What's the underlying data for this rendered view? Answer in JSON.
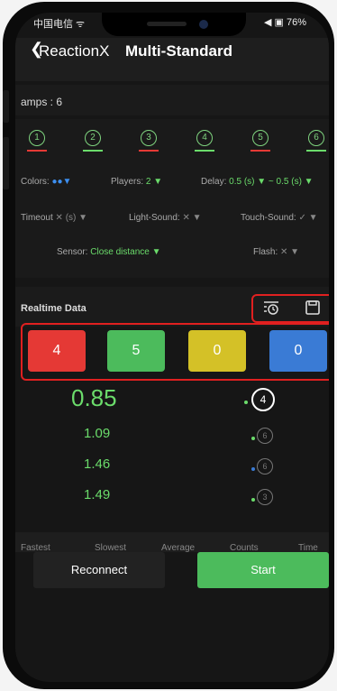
{
  "status_bar": {
    "carrier": "中国电信 ᯤ",
    "battery": "◀ ▣ 76%"
  },
  "header": {
    "back_symbol": "❮",
    "app_name": "ReactionX",
    "title": "Multi-Standard"
  },
  "lamps": {
    "label": "amps : 6",
    "items": [
      {
        "num": "1",
        "bar_color": "#e53935"
      },
      {
        "num": "2",
        "bar_color": "#6bdc6b"
      },
      {
        "num": "3",
        "bar_color": "#e53935"
      },
      {
        "num": "4",
        "bar_color": "#6bdc6b"
      },
      {
        "num": "5",
        "bar_color": "#e53935"
      },
      {
        "num": "6",
        "bar_color": "#6bdc6b"
      }
    ]
  },
  "options": {
    "colors_label": "Colors:",
    "colors_value": "●●▼",
    "players_label": "Players:",
    "players_value": "2 ▼",
    "delay_label": "Delay:",
    "delay_value": "0.5 (s) ▼ ~ 0.5 (s) ▼",
    "timeout_label": "Timeout",
    "timeout_value": "✕ (s) ▼",
    "light_sound_label": "Light-Sound:",
    "light_sound_value": "✕ ▼",
    "touch_sound_label": "Touch-Sound:",
    "touch_sound_value": "✓ ▼",
    "sensor_label": "Sensor:",
    "sensor_value": "Close distance ▼",
    "flash_label": "Flash:",
    "flash_value": "✕ ▼"
  },
  "realtime": {
    "label": "Realtime Data",
    "icons": [
      "history-icon",
      "save-icon"
    ]
  },
  "scores": [
    {
      "value": "4",
      "color": "#e53935"
    },
    {
      "value": "5",
      "color": "#4cbb5c"
    },
    {
      "value": "0",
      "color": "#d4c127"
    },
    {
      "value": "0",
      "color": "#3a7bd5"
    }
  ],
  "times": {
    "main": "0.85",
    "main_lamp": "4",
    "list": [
      {
        "value": "1.09",
        "lamp": "6",
        "dot": "#6bdc6b"
      },
      {
        "value": "1.46",
        "lamp": "6",
        "dot": "#3a7bd5"
      },
      {
        "value": "1.49",
        "lamp": "3",
        "dot": "#6bdc6b"
      }
    ]
  },
  "stats": [
    "Fastest",
    "Slowest",
    "Average",
    "Counts",
    "Time"
  ],
  "buttons": {
    "reconnect": "Reconnect",
    "start": "Start"
  }
}
